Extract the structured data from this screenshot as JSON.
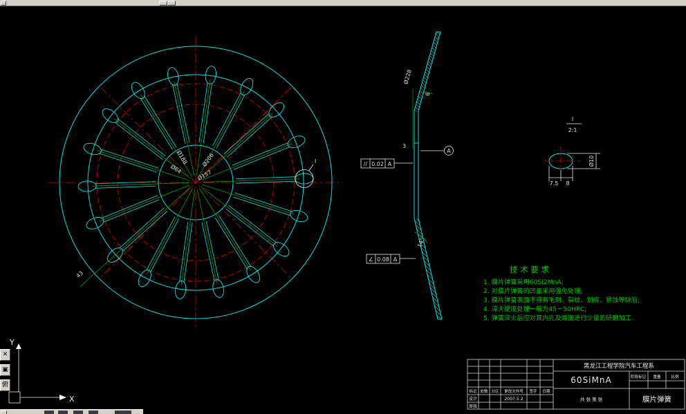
{
  "front_view": {
    "d188": "Ø188",
    "d64": "Ø64",
    "d206": "Ø206",
    "d157": "Ø157",
    "dim43": "43",
    "detail_ref": "I"
  },
  "side_view": {
    "t3": "3",
    "t6": "6",
    "od": "Ø228",
    "angle": "14°",
    "gdt": [
      {
        "sym": "//",
        "tol": "0.02",
        "datum": "A"
      },
      {
        "sym": "∠",
        "tol": "0.08",
        "datum": "A"
      }
    ],
    "datum_label": "A"
  },
  "detail_view": {
    "ref": "I",
    "scale": "2:1",
    "dia": "Ø10",
    "a": "7.5",
    "b": "8"
  },
  "tech_req": {
    "title": "技 术 要 求",
    "items": [
      "1. 膜片弹簧采用60Si2MnA;",
      "2. 对膜片弹簧的凹面采用强化处理;",
      "3. 膜片弹簧表面不得有毛刺、裂纹、划痕、锈蚀等缺陷;",
      "4. 淬火硬度处理一般为45－50HRC;",
      "5. 弹簧淬火后应对其内孔及端面进行少量的研磨加工."
    ]
  },
  "title_block": {
    "school": "黑龙江工程学院汽车工程系",
    "material": "60SiMnA",
    "part_name": "膜片弹簧",
    "date": "2007.5.2",
    "row_labels": [
      "标记",
      "处数",
      "分区",
      "更改文件号",
      "签字",
      "日期"
    ],
    "sign_labels": [
      "设计",
      "审核"
    ],
    "stage_labels": [
      "阶段标记",
      "重量",
      "比例"
    ],
    "sheet": "共 张 第 张"
  },
  "ucs": {
    "x": "X",
    "y": "Y"
  },
  "chrome": {
    "side_buttons": [
      "✕",
      "▣",
      "俯"
    ]
  }
}
